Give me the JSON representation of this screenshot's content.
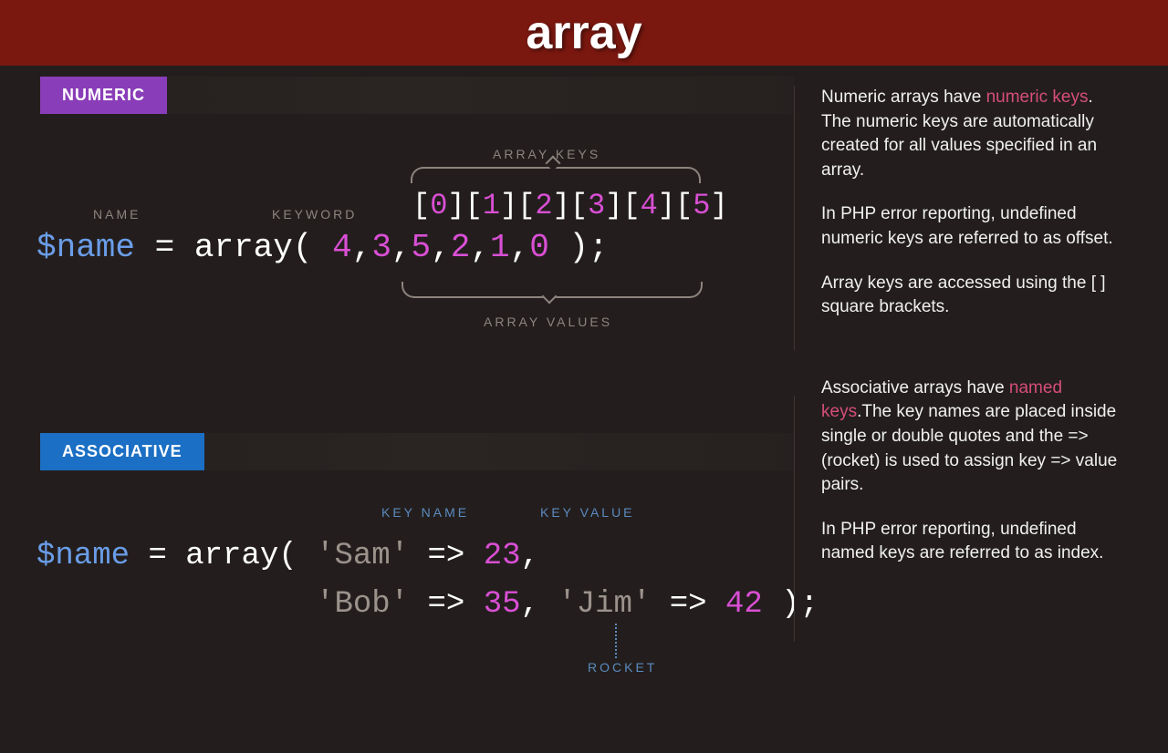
{
  "title": "array",
  "sections": {
    "numeric": {
      "tab": "NUMERIC",
      "labels": {
        "name": "NAME",
        "keyword": "KEYWORD",
        "arrayKeys": "ARRAY KEYS",
        "arrayValues": "ARRAY VALUES"
      },
      "code": {
        "var": "$name",
        "assign": "=",
        "keyword": "array(",
        "keys": [
          "0",
          "1",
          "2",
          "3",
          "4",
          "5"
        ],
        "values": [
          "4",
          "3",
          "5",
          "2",
          "1",
          "0"
        ],
        "close": ");"
      },
      "description": {
        "p1_a": "Numeric arrays have ",
        "p1_hl": "numeric keys",
        "p1_b": ". The numeric keys are automatically created for all values specified in an array.",
        "p2": "In PHP error reporting, undefined numeric keys are referred to as offset.",
        "p3": "Array keys are accessed using the [  ] square brackets."
      }
    },
    "associative": {
      "tab": "ASSOCIATIVE",
      "labels": {
        "keyName": "KEY NAME",
        "keyValue": "KEY VALUE",
        "rocket": "ROCKET"
      },
      "code": {
        "var": "$name",
        "assign": "=",
        "keyword": "array(",
        "pairs": [
          {
            "k": "'Sam'",
            "v": "23"
          },
          {
            "k": "'Bob'",
            "v": "35"
          },
          {
            "k": "'Jim'",
            "v": "42"
          }
        ],
        "arrow": "=>",
        "close": ");"
      },
      "description": {
        "p1_a": "Associative arrays have ",
        "p1_hl": "named keys",
        "p1_b": ".The key names are placed inside single or double quotes and the => (rocket) is used to assign key => value pairs.",
        "p2": "In PHP error reporting, undefined named keys are referred to as index."
      }
    }
  }
}
